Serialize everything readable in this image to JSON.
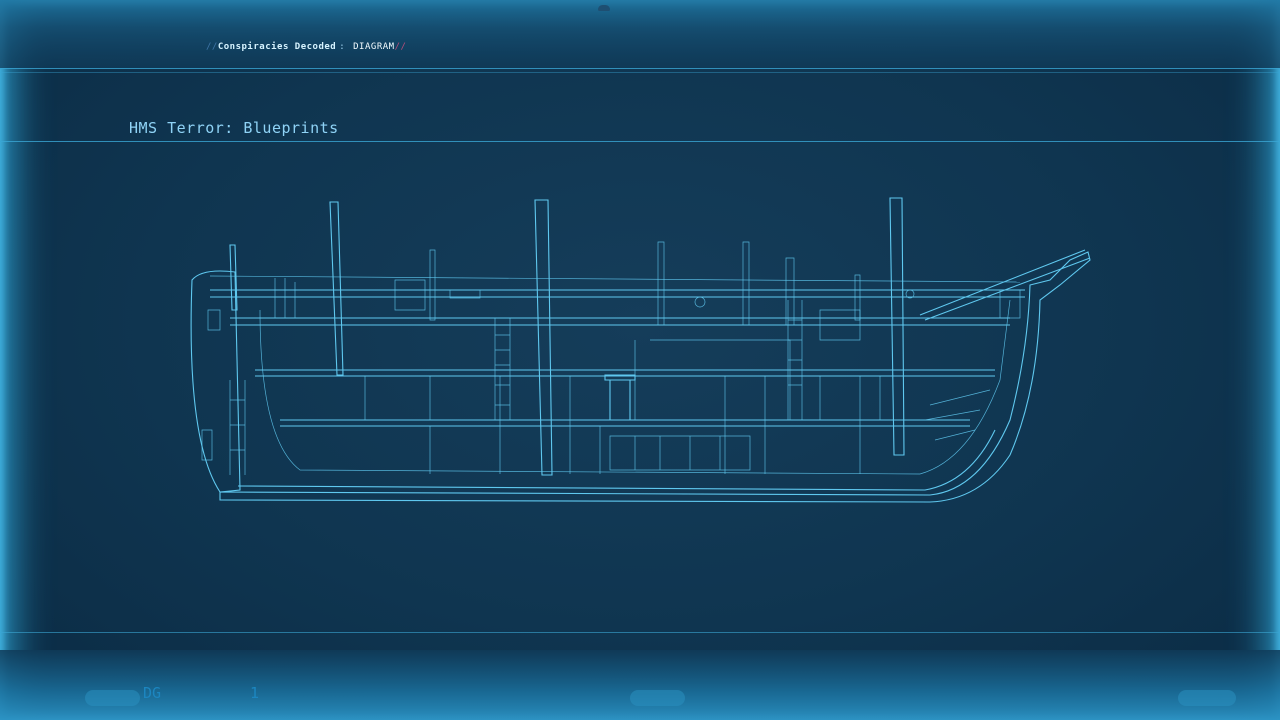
{
  "header": {
    "breadcrumb_prefix": "//",
    "breadcrumb_show": "Conspiracies Decoded",
    "breadcrumb_separator": ":",
    "breadcrumb_tag": "DIAGRAM",
    "breadcrumb_suffix": "//"
  },
  "main": {
    "title": "HMS Terror: Blueprints"
  },
  "footer": {
    "left_label": "DG",
    "number": "1"
  },
  "colors": {
    "background": "#0f3550",
    "line": "#5fc8ef",
    "glow": "#2fa7d8",
    "accent": "#b44d7a"
  }
}
